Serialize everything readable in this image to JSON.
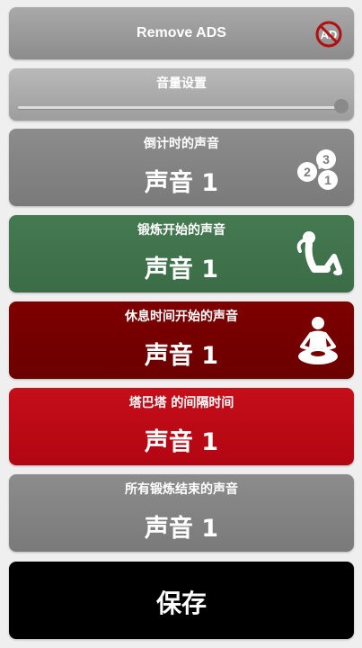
{
  "remove_ads": {
    "label": "Remove ADS",
    "icon": "no-ads-icon"
  },
  "volume": {
    "label": "音量设置",
    "level": 1.0
  },
  "sounds": [
    {
      "title": "倒计时的声音",
      "value": "声音 1",
      "icon": "countdown-bubbles-icon",
      "color": "#858585"
    },
    {
      "title": "锻炼开始的声音",
      "value": "声音 1",
      "icon": "situp-exercise-icon",
      "color": "#3f6f4a"
    },
    {
      "title": "休息时间开始的声音",
      "value": "声音 1",
      "icon": "meditation-rest-icon",
      "color": "#760000"
    },
    {
      "title": "塔巴塔 的间隔时间",
      "value": "声音 1",
      "color": "#bb0a16"
    },
    {
      "title": "所有锻炼结束的声音",
      "value": "声音 1",
      "color": "#858585"
    }
  ],
  "save": {
    "label": "保存"
  }
}
